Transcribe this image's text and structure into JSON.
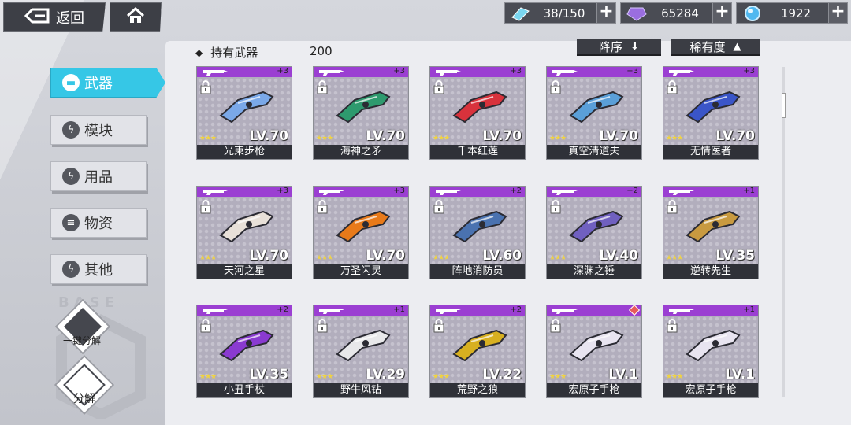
{
  "topbar": {
    "back_label": "返回",
    "stamina": "38/150",
    "gems": "65284",
    "crystals": "1922",
    "plus": "+"
  },
  "nav": [
    {
      "label": "武器",
      "icon": "gun-icon",
      "active": true
    },
    {
      "label": "模块",
      "icon": "lightning-icon",
      "active": false
    },
    {
      "label": "用品",
      "icon": "lightning-icon",
      "active": false
    },
    {
      "label": "物资",
      "icon": "box-icon",
      "active": false
    },
    {
      "label": "其他",
      "icon": "lightning-icon",
      "active": false
    }
  ],
  "side_actions": {
    "base_text": "BASE",
    "quick_dismantle": "一键分解",
    "dismantle": "分解"
  },
  "header": {
    "owned_label": "持有武器",
    "owned_count": "200",
    "sort_desc": "降序",
    "sort_rarity": "稀有度"
  },
  "colors": {
    "accent": "#36c7e6",
    "rarity_purple": "#9b3fd2",
    "star": "#f0d340"
  },
  "weapons": [
    {
      "name": "光束步枪",
      "level": "LV.70",
      "stars": "★★★",
      "plus": "+3",
      "weapon_color": "#7aa8e8"
    },
    {
      "name": "海神之矛",
      "level": "LV.70",
      "stars": "★★★",
      "plus": "+3",
      "weapon_color": "#2e9a6e"
    },
    {
      "name": "千本红莲",
      "level": "LV.70",
      "stars": "★★★",
      "plus": "+3",
      "weapon_color": "#d8323c"
    },
    {
      "name": "真空清道夫",
      "level": "LV.70",
      "stars": "★★★",
      "plus": "+3",
      "weapon_color": "#5a9fd8"
    },
    {
      "name": "无情医者",
      "level": "LV.70",
      "stars": "★★★",
      "plus": "+3",
      "weapon_color": "#3a55c8"
    },
    {
      "name": "天河之星",
      "level": "LV.70",
      "stars": "★★★",
      "plus": "+3",
      "weapon_color": "#e8e0d8"
    },
    {
      "name": "万圣闪灵",
      "level": "LV.70",
      "stars": "★★★",
      "plus": "+3",
      "weapon_color": "#e87a1a"
    },
    {
      "name": "阵地消防员",
      "level": "LV.60",
      "stars": "★★★",
      "plus": "+2",
      "weapon_color": "#4a72b0"
    },
    {
      "name": "深渊之锤",
      "level": "LV.40",
      "stars": "★★★",
      "plus": "+2",
      "weapon_color": "#7060c0"
    },
    {
      "name": "逆转先生",
      "level": "LV.35",
      "stars": "★★★",
      "plus": "+1",
      "weapon_color": "#c89a40"
    },
    {
      "name": "小丑手杖",
      "level": "LV.35",
      "stars": "★★★",
      "plus": "+2",
      "weapon_color": "#8a3ad0"
    },
    {
      "name": "野牛风钻",
      "level": "LV.29",
      "stars": "★★★",
      "plus": "+1",
      "weapon_color": "#e8e8ea"
    },
    {
      "name": "荒野之狼",
      "level": "LV.22",
      "stars": "★★★",
      "plus": "+2",
      "weapon_color": "#d8b020"
    },
    {
      "name": "宏原子手枪",
      "level": "LV.1",
      "stars": "★★★",
      "plus": "",
      "weapon_color": "#e8e4f0"
    },
    {
      "name": "宏原子手枪",
      "level": "LV.1",
      "stars": "★★★",
      "plus": "+1",
      "weapon_color": "#e8e4f0"
    }
  ]
}
